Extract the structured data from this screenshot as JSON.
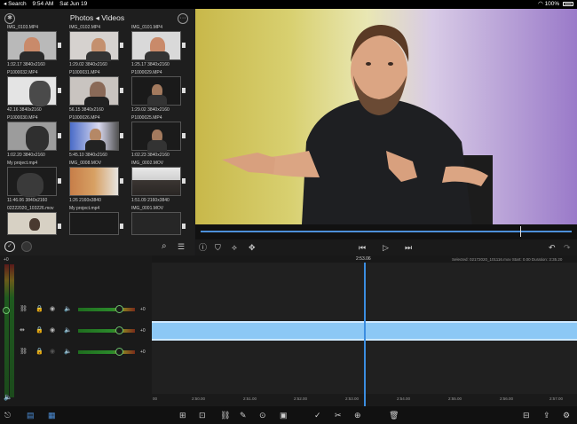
{
  "status_bar": {
    "back": "◂ Search",
    "time": "9:54 AM",
    "date": "Sat Jun 19",
    "battery": "100%"
  },
  "browser": {
    "title": "Photos ◂ Videos",
    "items": [
      {
        "name": "IMG_0103.MP4",
        "meta": "1:32.17  3840x2160"
      },
      {
        "name": "IMG_0102.MP4",
        "meta": "1:29.02  3840x2160"
      },
      {
        "name": "IMG_0101.MP4",
        "meta": "1:25.17  3840x2160"
      },
      {
        "name": "P1000032.MP4",
        "meta": "42.16  3840x2160"
      },
      {
        "name": "P1000031.MP4",
        "meta": "56.15  3840x2160"
      },
      {
        "name": "P1000029.MP4",
        "meta": "1:29.02  3840x2160"
      },
      {
        "name": "P1000030.MP4",
        "meta": "1:02.20  3840x2160"
      },
      {
        "name": "P1000026.MP4",
        "meta": "5:45.10  3840x2160"
      },
      {
        "name": "P1000025.MP4",
        "meta": "1:02.23  3840x2160"
      },
      {
        "name": "My project.mp4",
        "meta": "11:46.06  3840x2160"
      },
      {
        "name": "IMG_0008.MOV",
        "meta": "1:26  2160x3840"
      },
      {
        "name": "IMG_0002.MOV",
        "meta": "1:51.09  2160x3840"
      },
      {
        "name": "02222020_103226.mov",
        "meta": ""
      },
      {
        "name": "My project.mp4",
        "meta": ""
      },
      {
        "name": "IMG_0001.MOV",
        "meta": ""
      }
    ]
  },
  "timeline": {
    "playhead_time": "2:53.06",
    "selected_info": "Selected: 02172020_101116.mov Start: 0.00 Duration: 3:35.20",
    "db_label": "+0",
    "ruler": [
      "2:50.00",
      "2:51.00",
      "2:52.00",
      "2:53.00",
      "2:54.00",
      "2:55.00",
      "2:56.00",
      "2:57.00"
    ],
    "ruler_zero": "00"
  }
}
